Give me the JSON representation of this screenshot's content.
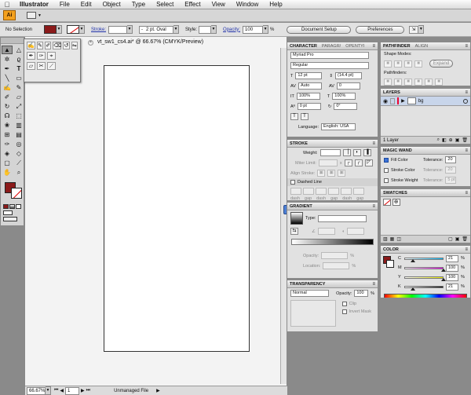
{
  "menubar": {
    "items": [
      "Illustrator",
      "File",
      "Edit",
      "Object",
      "Type",
      "Select",
      "Effect",
      "View",
      "Window",
      "Help"
    ]
  },
  "appbar": {
    "logo": "Ai"
  },
  "controlbar": {
    "selection": "No Selection",
    "stroke_label": "Stroke:",
    "brush": "2 pt. Oval",
    "style_label": "Style:",
    "opacity_label": "Opacity:",
    "opacity_value": "100",
    "opacity_unit": "%",
    "document_setup": "Document Setup",
    "preferences": "Preferences"
  },
  "document": {
    "tab_title": "vt_sw1_cs4.ai* @ 66.67% (CMYK/Preview)",
    "zoom": "66.67%",
    "page": "1",
    "status": "Unmanaged File"
  },
  "character": {
    "tabs": [
      "CHARACTER",
      "PARAGR/",
      "OPENTYI"
    ],
    "font": "Myriad Pro",
    "style": "Regular",
    "size": "12 pt",
    "leading": "(14.4 pt)",
    "kerning": "Auto",
    "tracking": "0",
    "vscale": "100%",
    "hscale": "100%",
    "baseline": "0 pt",
    "rotation": "0°",
    "language_label": "Language:",
    "language": "English: USA"
  },
  "stroke": {
    "title": "STROKE",
    "weight_label": "Weight:",
    "miter_label": "Miter Limit:",
    "miter_x": "x",
    "align_label": "Align Stroke:",
    "dashed_label": "Dashed Line",
    "dash_labels": [
      "dash",
      "gap",
      "dash",
      "gap",
      "dash",
      "gap"
    ]
  },
  "gradient": {
    "title": "GRADIENT",
    "type_label": "Type:",
    "opacity_label": "Opacity:",
    "location_label": "Location:",
    "percent": "%"
  },
  "transparency": {
    "title": "TRANSPARENCY",
    "mode": "Normal",
    "opacity_label": "Opacity:",
    "opacity_value": "100",
    "percent": "%",
    "clip_label": "Clip",
    "invert_label": "Invert Mask"
  },
  "pathfinder": {
    "tabs": [
      "PATHFINDER",
      "ALIGN"
    ],
    "shape_modes_label": "Shape Modes:",
    "expand_label": "Expand",
    "pathfinders_label": "Pathfinders:"
  },
  "layers": {
    "title": "LAYERS",
    "layer_name": "bg",
    "footer": "1 Layer"
  },
  "magic_wand": {
    "title": "MAGIC WAND",
    "tolerance_label": "Tolerance:",
    "rows": [
      {
        "label": "Fill Color",
        "value": "20",
        "checked": true
      },
      {
        "label": "Stroke Color",
        "value": "20",
        "checked": false
      },
      {
        "label": "Stroke Weight",
        "value": "5 pt",
        "checked": false
      }
    ]
  },
  "swatches": {
    "title": "SWATCHES"
  },
  "color": {
    "title": "COLOR",
    "fill_color": "#8b1a1a",
    "channels": [
      {
        "label": "C",
        "value": "21",
        "pct": 21,
        "gradient": "linear-gradient(to right,#fff,#0bf)"
      },
      {
        "label": "M",
        "value": "100",
        "pct": 100,
        "gradient": "linear-gradient(to right,#fff,#e0e)"
      },
      {
        "label": "Y",
        "value": "100",
        "pct": 100,
        "gradient": "linear-gradient(to right,#fff,#ee0)"
      },
      {
        "label": "K",
        "value": "21",
        "pct": 21,
        "gradient": "linear-gradient(to right,#fff,#000)"
      }
    ],
    "percent": "%"
  }
}
